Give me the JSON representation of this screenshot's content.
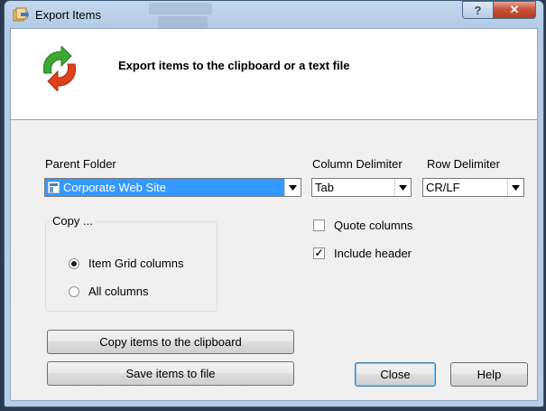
{
  "window": {
    "title": "Export Items",
    "help_button": "?",
    "close_button": "✕"
  },
  "header": {
    "text": "Export items to the clipboard or a text file"
  },
  "parent_folder": {
    "label": "Parent Folder",
    "value": "Corporate Web Site"
  },
  "column_delimiter": {
    "label": "Column Delimiter",
    "value": "Tab"
  },
  "row_delimiter": {
    "label": "Row Delimiter",
    "value": "CR/LF"
  },
  "copy_group": {
    "title": "Copy ...",
    "options": [
      {
        "label": "Item Grid columns",
        "selected": true
      },
      {
        "label": "All columns",
        "selected": false
      }
    ]
  },
  "options": {
    "quote_columns": {
      "label": "Quote columns",
      "checked": false
    },
    "include_header": {
      "label": "Include header",
      "checked": true
    }
  },
  "buttons": {
    "copy_clipboard": "Copy items to the clipboard",
    "save_file": "Save items to file",
    "close": "Close",
    "help": "Help"
  },
  "icons": {
    "title_icon": "export-items-icon",
    "header_icon": "refresh-arrows-icon",
    "dropdown_arrow": "▼"
  },
  "colors": {
    "selection": "#3399ff",
    "titlebar": "#b9cfe8",
    "close_button": "#c8553d",
    "arrow_green": "#3aa832",
    "arrow_red": "#e0401c"
  }
}
